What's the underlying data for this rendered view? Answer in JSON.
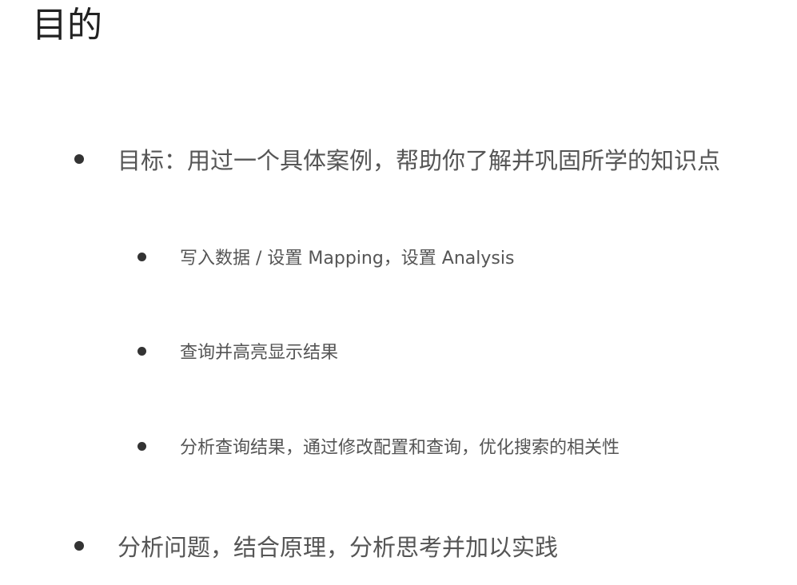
{
  "slide": {
    "title": "目的",
    "bullets": [
      {
        "text": "目标：用过一个具体案例，帮助你了解并巩固所学的知识点",
        "sub_bullets": [
          {
            "text": "写入数据 / 设置 Mapping，设置 Analysis"
          },
          {
            "text": "查询并高亮显示结果"
          },
          {
            "text": "分析查询结果，通过修改配置和查询，优化搜索的相关性"
          }
        ]
      },
      {
        "text": "分析问题，结合原理，分析思考并加以实践"
      }
    ]
  }
}
